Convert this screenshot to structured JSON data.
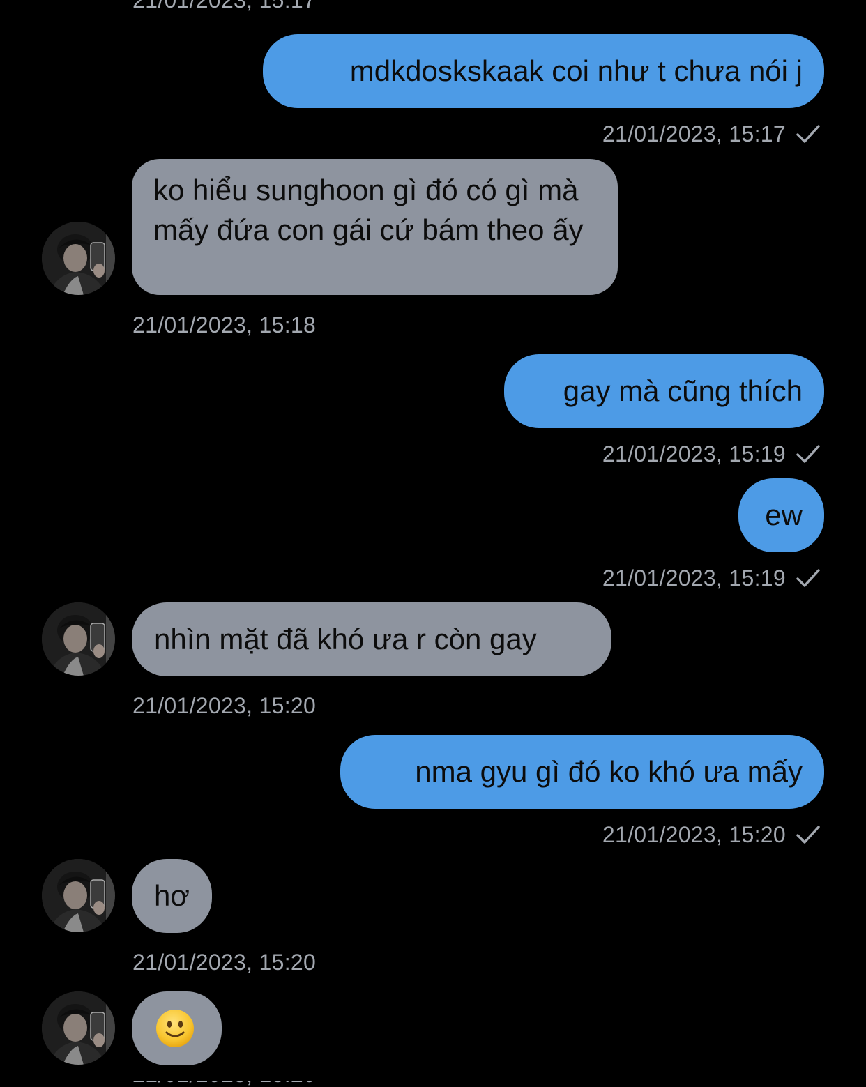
{
  "colors": {
    "background": "#000000",
    "outgoing_bubble": "#4d9be6",
    "incoming_bubble": "#8e949f",
    "timestamp_text": "#a3a8b0",
    "message_text": "#0c0c0c"
  },
  "top_partial_timestamp": "21/01/2023, 15:17",
  "messages": [
    {
      "direction": "outgoing",
      "text": "mdkdoskskaak coi như t chưa nói j",
      "timestamp": "21/01/2023, 15:17",
      "status_icon": "checkmark-icon"
    },
    {
      "direction": "incoming",
      "text": "ko hiểu sunghoon gì đó có gì mà mấy đứa con gái cứ bám theo ấy",
      "timestamp": "21/01/2023, 15:18",
      "avatar": "contact-avatar"
    },
    {
      "direction": "outgoing",
      "text": "gay mà cũng thích",
      "timestamp": "21/01/2023, 15:19",
      "status_icon": "checkmark-icon"
    },
    {
      "direction": "outgoing",
      "text": "ew",
      "timestamp": "21/01/2023, 15:19",
      "status_icon": "checkmark-icon"
    },
    {
      "direction": "incoming",
      "text": "nhìn mặt đã khó ưa r còn gay",
      "timestamp": "21/01/2023, 15:20",
      "avatar": "contact-avatar"
    },
    {
      "direction": "outgoing",
      "text": "nma gyu gì đó ko khó ưa mấy",
      "timestamp": "21/01/2023, 15:20",
      "status_icon": "checkmark-icon"
    },
    {
      "direction": "incoming",
      "text": "hơ",
      "timestamp": "21/01/2023, 15:20",
      "avatar": "contact-avatar"
    },
    {
      "direction": "incoming",
      "emoji": "slightly-smiling-face-emoji",
      "avatar": "contact-avatar"
    }
  ]
}
